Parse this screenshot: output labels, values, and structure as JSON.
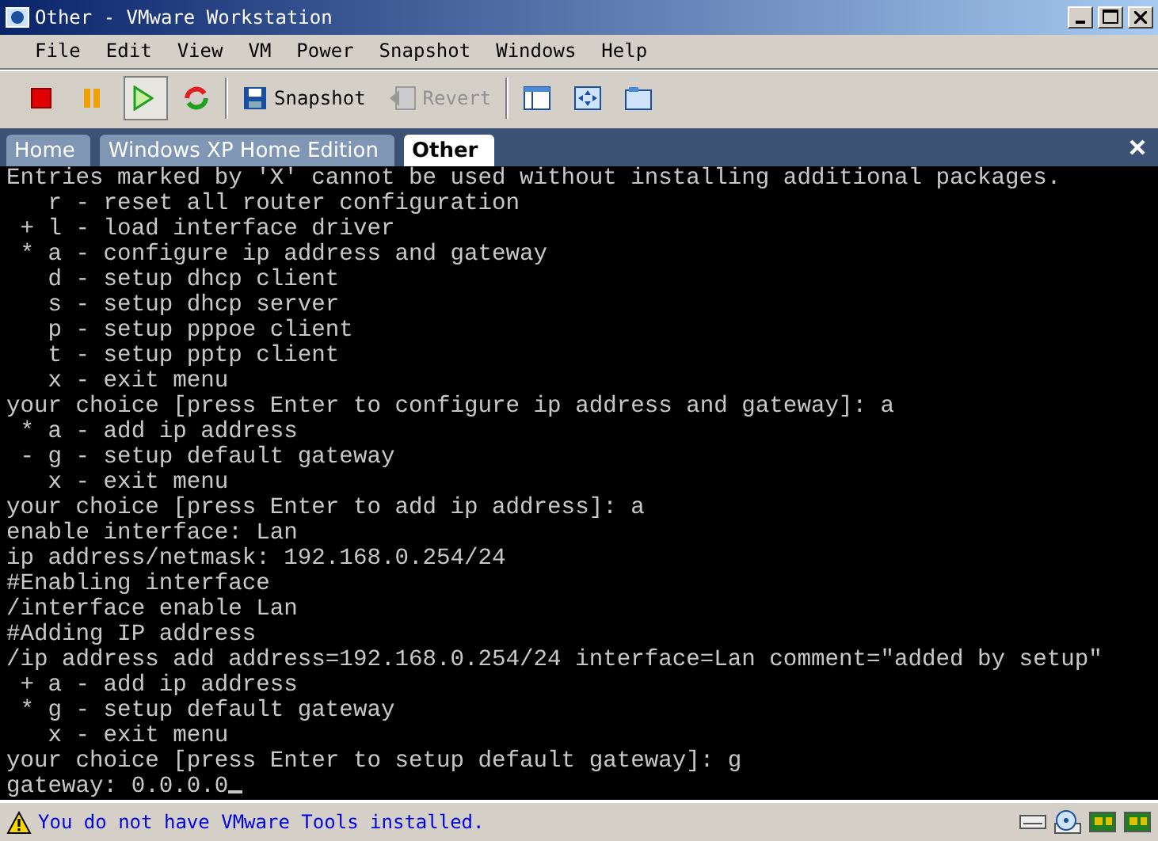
{
  "window": {
    "title": "Other - VMware Workstation"
  },
  "menu": [
    "File",
    "Edit",
    "View",
    "VM",
    "Power",
    "Snapshot",
    "Windows",
    "Help"
  ],
  "toolbar": [
    {
      "kind": "stop",
      "pressed": false
    },
    {
      "kind": "pause",
      "pressed": false
    },
    {
      "kind": "play",
      "pressed": true
    },
    {
      "kind": "reset",
      "pressed": false
    },
    {
      "kind": "separator"
    },
    {
      "kind": "snapshot",
      "label": "Snapshot",
      "pressed": false,
      "disabled": false
    },
    {
      "kind": "revert",
      "label": "Revert",
      "pressed": false,
      "disabled": true
    },
    {
      "kind": "separator"
    },
    {
      "kind": "sidebar",
      "pressed": false
    },
    {
      "kind": "fullscreen",
      "pressed": false
    },
    {
      "kind": "tabs",
      "pressed": false
    }
  ],
  "tabs": [
    {
      "label": "Home",
      "selected": false
    },
    {
      "label": "Windows XP Home Edition",
      "selected": false
    },
    {
      "label": "Other",
      "selected": true
    }
  ],
  "console": {
    "lines": [
      "Entries marked by 'X' cannot be used without installing additional packages.",
      "   r - reset all router configuration",
      " + l - load interface driver",
      " * a - configure ip address and gateway",
      "   d - setup dhcp client",
      "   s - setup dhcp server",
      "   p - setup pppoe client",
      "   t - setup pptp client",
      "   x - exit menu",
      "your choice [press Enter to configure ip address and gateway]: a",
      " * a - add ip address",
      " - g - setup default gateway",
      "   x - exit menu",
      "your choice [press Enter to add ip address]: a",
      "enable interface: Lan",
      "ip address/netmask: 192.168.0.254/24",
      "#Enabling interface",
      "/interface enable Lan",
      "#Adding IP address",
      "/ip address add address=192.168.0.254/24 interface=Lan comment=\"added by setup\"",
      " + a - add ip address",
      " * g - setup default gateway",
      "   x - exit menu",
      "your choice [press Enter to setup default gateway]: g",
      "gateway: 0.0.0.0"
    ],
    "cursor": true
  },
  "status_bar": {
    "message": "You do not have VMware Tools installed."
  }
}
